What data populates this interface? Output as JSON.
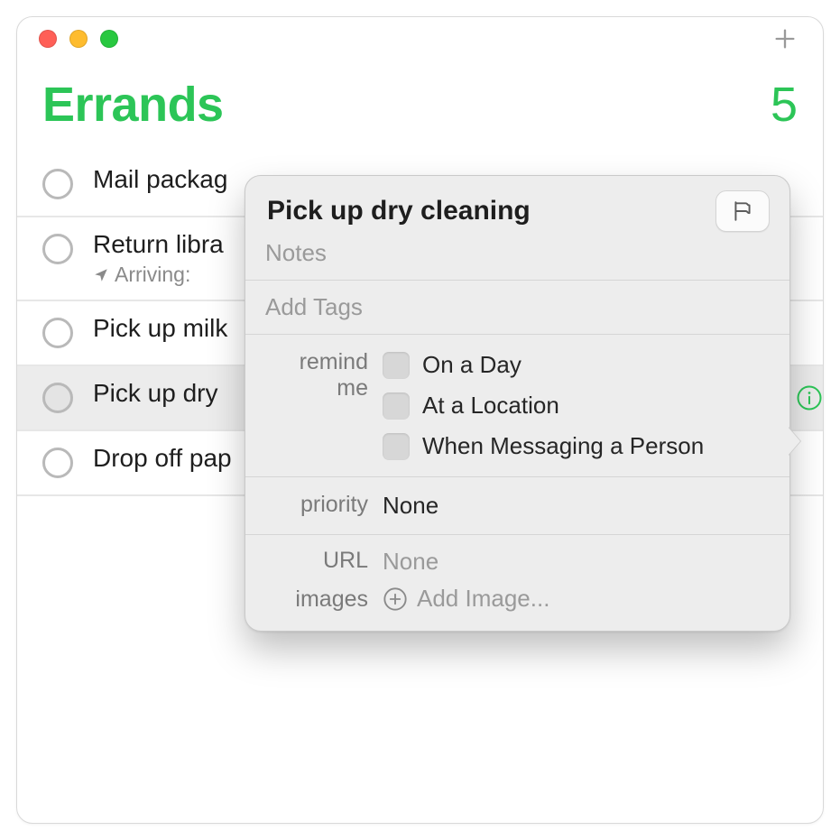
{
  "colors": {
    "accent": "#2cc557",
    "trafficRed": "#ff5f57",
    "trafficYellow": "#febc2e",
    "trafficGreen": "#28c840"
  },
  "header": {
    "title": "Errands",
    "count": "5"
  },
  "reminders": [
    {
      "title": "Mail packag",
      "subtitle": ""
    },
    {
      "title": "Return libra",
      "subtitle": "Arriving:"
    },
    {
      "title": "Pick up milk",
      "subtitle": ""
    },
    {
      "title": "Pick up dry",
      "subtitle": ""
    },
    {
      "title": "Drop off pap",
      "subtitle": ""
    }
  ],
  "popover": {
    "title": "Pick up dry cleaning",
    "notesPlaceholder": "Notes",
    "tagsPlaceholder": "Add Tags",
    "remindLabel": "remind me",
    "remindOptions": {
      "onDay": "On a Day",
      "atLocation": "At a Location",
      "messaging": "When Messaging a Person"
    },
    "priorityLabel": "priority",
    "priorityValue": "None",
    "urlLabel": "URL",
    "urlValue": "None",
    "imagesLabel": "images",
    "addImageLabel": "Add Image..."
  }
}
